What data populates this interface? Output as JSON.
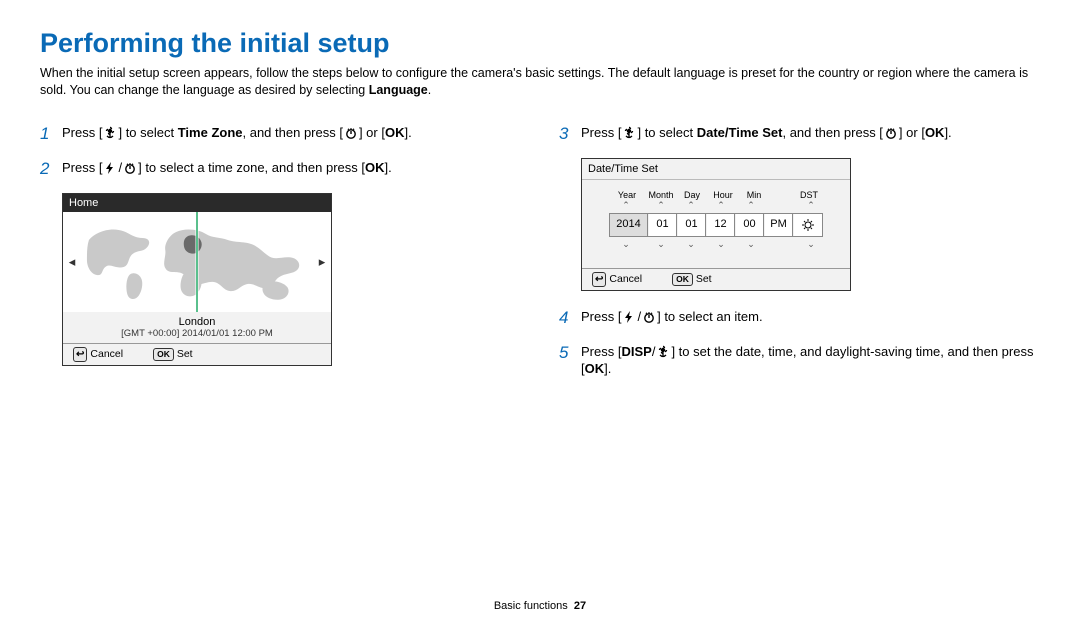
{
  "page_title": "Performing the initial setup",
  "intro_a": "When the initial setup screen appears, follow the steps below to configure the camera's basic settings. The default language is preset for the country or region where the camera is sold. You can change the language as desired by selecting ",
  "intro_b": "Language",
  "intro_c": ".",
  "steps": {
    "s1": {
      "num": "1",
      "pre": "Press [",
      "mid1": "] to select ",
      "bold": "Time Zone",
      "mid2": ", and then press [",
      "or": "] or [",
      "end": "]."
    },
    "s2": {
      "num": "2",
      "pre": "Press [",
      "mid": "] to select a time zone, and then press [",
      "end": "]."
    },
    "s3": {
      "num": "3",
      "pre": "Press [",
      "mid1": "] to select ",
      "bold": "Date/Time Set",
      "mid2": ", and then press [",
      "or": "] or [",
      "end": "]."
    },
    "s4": {
      "num": "4",
      "pre": "Press [",
      "mid": "] to select an item."
    },
    "s5": {
      "num": "5",
      "pre": "Press [",
      "mid": "] to set the date, time, and daylight-saving time, and then press [",
      "end": "]."
    }
  },
  "tz": {
    "title": "Home",
    "location": "London",
    "gmt": "[GMT +00:00] 2014/01/01 12:00 PM",
    "cancel": "Cancel",
    "set": "Set"
  },
  "dt": {
    "title": "Date/Time Set",
    "labels": [
      "Year",
      "Month",
      "Day",
      "Hour",
      "Min",
      "",
      "DST"
    ],
    "values": [
      "2014",
      "01",
      "01",
      "12",
      "00",
      "PM"
    ],
    "cancel": "Cancel",
    "set": "Set"
  },
  "footer": {
    "section": "Basic functions",
    "page": "27"
  },
  "ok_label": "OK",
  "disp_label": "DISP"
}
